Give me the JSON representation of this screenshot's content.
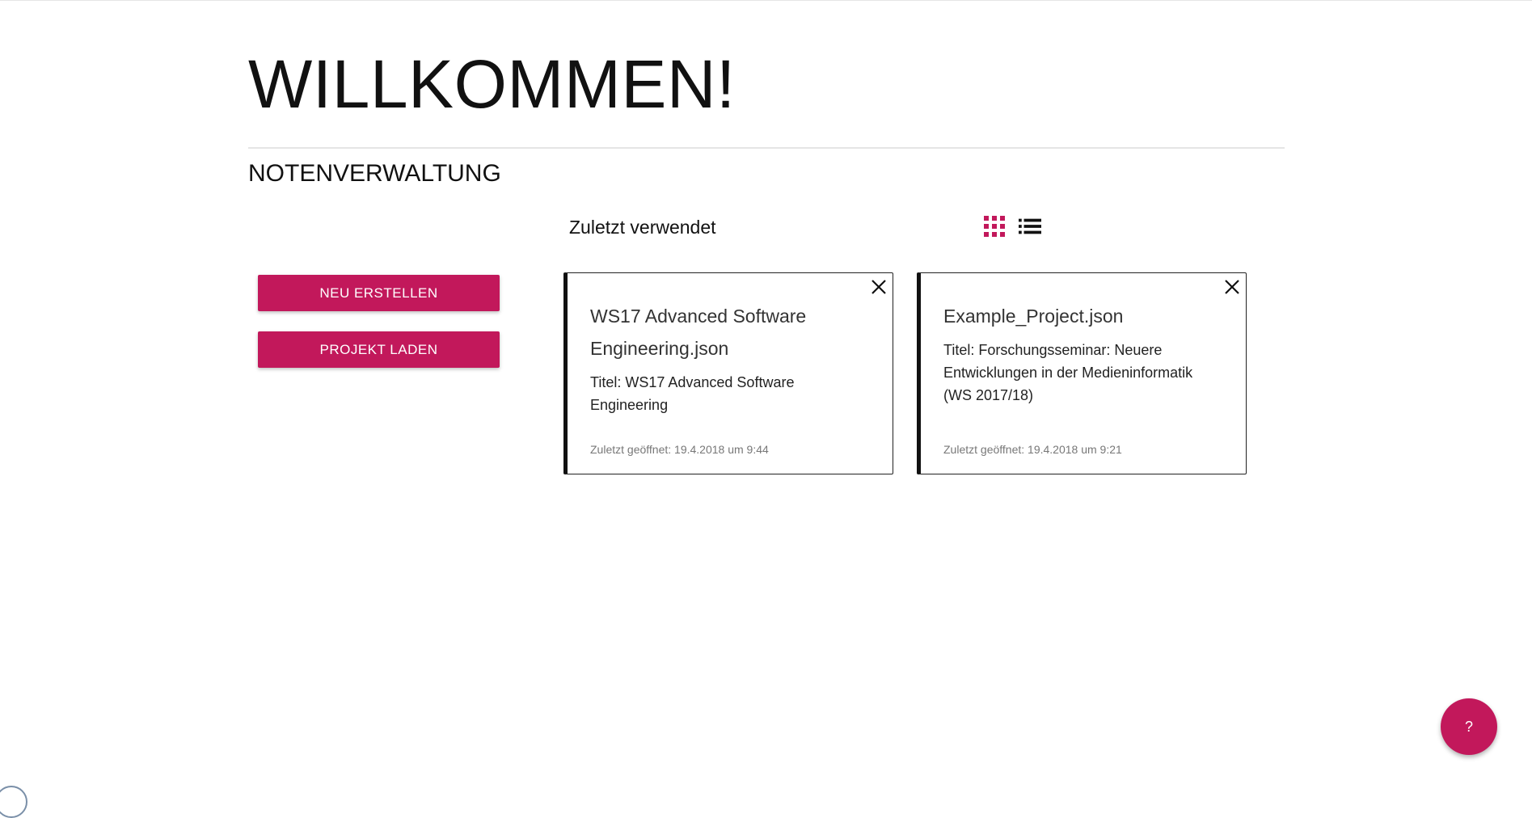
{
  "header": {
    "welcome": "WILLKOMMEN!",
    "section_title": "NOTENVERWALTUNG"
  },
  "actions": {
    "new_label": "NEU ERSTELLEN",
    "load_label": "PROJEKT LADEN"
  },
  "recent": {
    "label": "Zuletzt verwendet",
    "view_mode": "grid",
    "projects": [
      {
        "filename": "WS17 Advanced Software Engineering.json",
        "title": "Titel: WS17 Advanced Software Engineering",
        "opened": "Zuletzt geöffnet: 19.4.2018 um 9:44"
      },
      {
        "filename": "Example_Project.json",
        "title": "Titel: Forschungsseminar: Neuere Entwicklungen in der Medieninformatik (WS 2017/18)",
        "opened": "Zuletzt geöffnet: 19.4.2018 um 9:21"
      }
    ]
  },
  "help": {
    "label": "?"
  },
  "colors": {
    "accent": "#c2185b",
    "text": "#111111",
    "muted": "#777777"
  },
  "icons": {
    "grid_view": "grid-view-icon",
    "list_view": "list-view-icon",
    "close": "close-icon"
  }
}
